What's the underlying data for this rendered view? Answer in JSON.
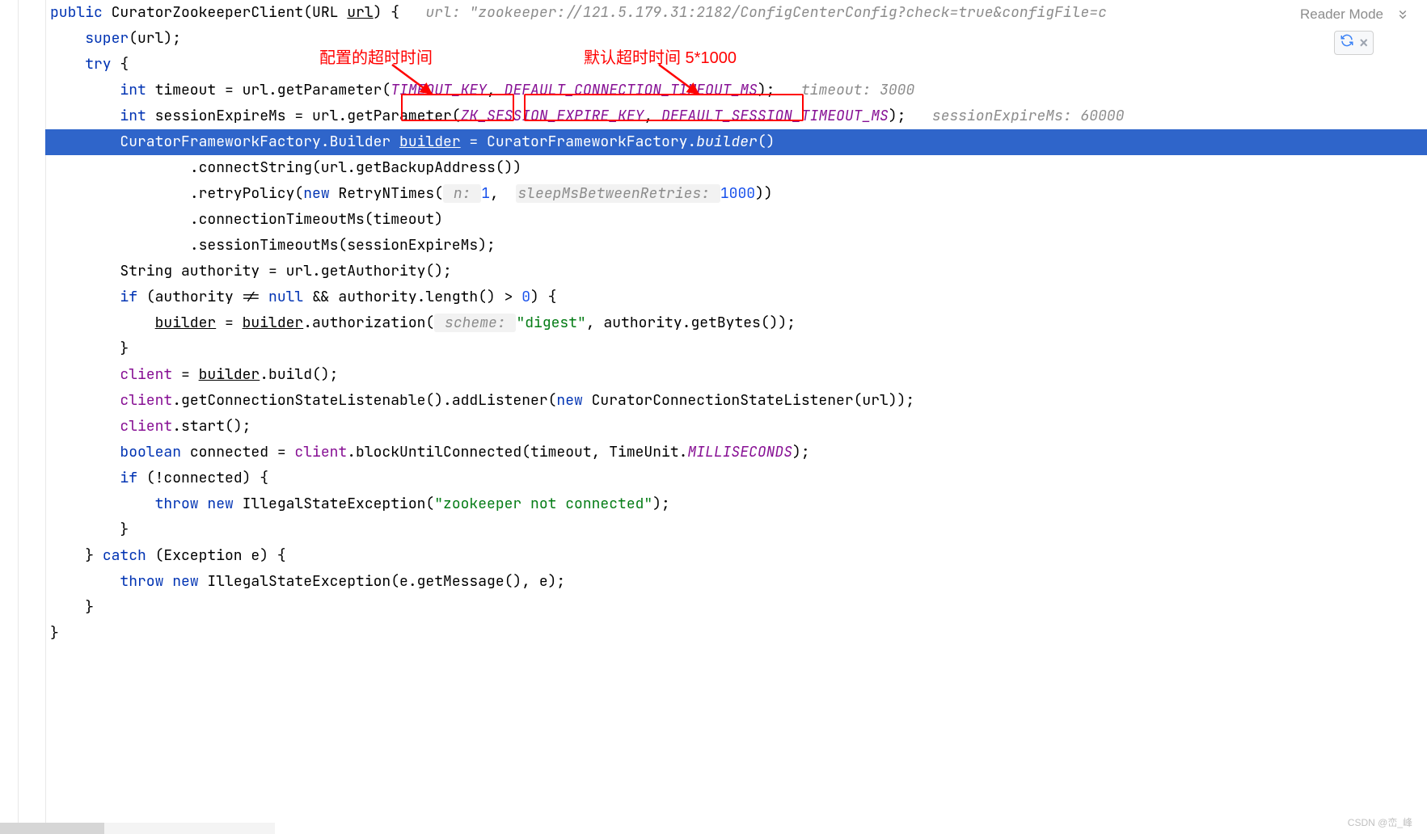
{
  "header": {
    "reader_mode": "Reader Mode"
  },
  "annotations": {
    "left_text": "配置的超时时间",
    "right_text": "默认超时时间 5*1000"
  },
  "code": {
    "kw_public": "public",
    "cls_name": "CuratorZookeeperClient",
    "paren_open": "(",
    "type_url": "URL",
    "param_url": "url",
    "paren_close": ")",
    "brace_open": " {",
    "hint_url": "url: \"zookeeper://121.5.179.31:2182/ConfigCenterConfig?check=true&configFile=c",
    "l2_super": "super",
    "l2_rest": "(url);",
    "kw_try": "try",
    "kw_int1": "int",
    "var_timeout": " timeout = url.getParameter(",
    "const_tk": "TIMEOUT_KEY",
    "comma1": ",",
    "const_dctm": "DEFAULT_CONNECTION_TIMEOUT_MS",
    "after_dctm": ");",
    "hint_timeout": "timeout: 3000",
    "kw_int2": "int",
    "var_sem": " sessionExpireMs = url.getParameter(",
    "const_zk": "ZK_SESSION_EXPIRE_KEY",
    "comma2": ",",
    "const_dstm": "DEFAULT_SESSION_TIMEOUT_MS",
    "after_dstm": ");",
    "hint_sem": "sessionExpireMs: 60000",
    "l6_pre": "CuratorFrameworkFactory.Builder ",
    "l6_builder": "builder",
    "l6_eq": " = CuratorFrameworkFactory.",
    "l6_builder_m": "builder",
    "l6_rest": "()",
    "l7": ".connectString(url.getBackupAddress())",
    "l8a": ".retryPolicy(",
    "l8_new": "new",
    "l8_cls": " RetryNTimes(",
    "l8_h1": " n: ",
    "l8_n1": "1",
    "l8_comma": ",  ",
    "l8_h2": "sleepMsBetweenRetries: ",
    "l8_n2": "1000",
    "l8_end": "))",
    "l9": ".connectionTimeoutMs(timeout)",
    "l10": ".sessionTimeoutMs(sessionExpireMs);",
    "l11": "String authority = url.getAuthority();",
    "l12a": "if",
    "l12b": " (authority != ",
    "l12_null": "null",
    "l12c": " && authority.length() > ",
    "l12_num": "0",
    "l12d": ") {",
    "l13a": "builder",
    "l13b": " = ",
    "l13c": "builder",
    "l13d": ".authorization(",
    "l13_hint": " scheme: ",
    "l13_str": "\"digest\"",
    "l13e": ", authority.getBytes());",
    "brace_close1": "}",
    "l15a": "client",
    "l15b": " = ",
    "l15c": "builder",
    "l15d": ".build();",
    "l16a": "client",
    "l16b": ".getConnectionStateListenable().addListener(",
    "l16_new": "new",
    "l16c": " CuratorConnectionStateListener(url));",
    "l17a": "client",
    "l17b": ".start();",
    "l18a": "boolean",
    "l18b": " connected = ",
    "l18c": "client",
    "l18d": ".blockUntilConnected(timeout, TimeUnit.",
    "l18e": "MILLISECONDS",
    "l18f": ");",
    "l19a": "if",
    "l19b": " (!connected) {",
    "l20a": "throw",
    "l20b": " ",
    "l20_new": "new",
    "l20c": " IllegalStateException(",
    "l20_str": "\"zookeeper not connected\"",
    "l20d": ");",
    "brace_close2": "}",
    "l22a": "} ",
    "l22_catch": "catch",
    "l22b": " (Exception e) {",
    "l23a": "throw",
    "l23b": " ",
    "l23_new": "new",
    "l23c": " IllegalStateException(e.getMessage(), e);",
    "brace_close3": "}",
    "brace_close4": "}"
  },
  "watermark": "CSDN @峦_峰"
}
